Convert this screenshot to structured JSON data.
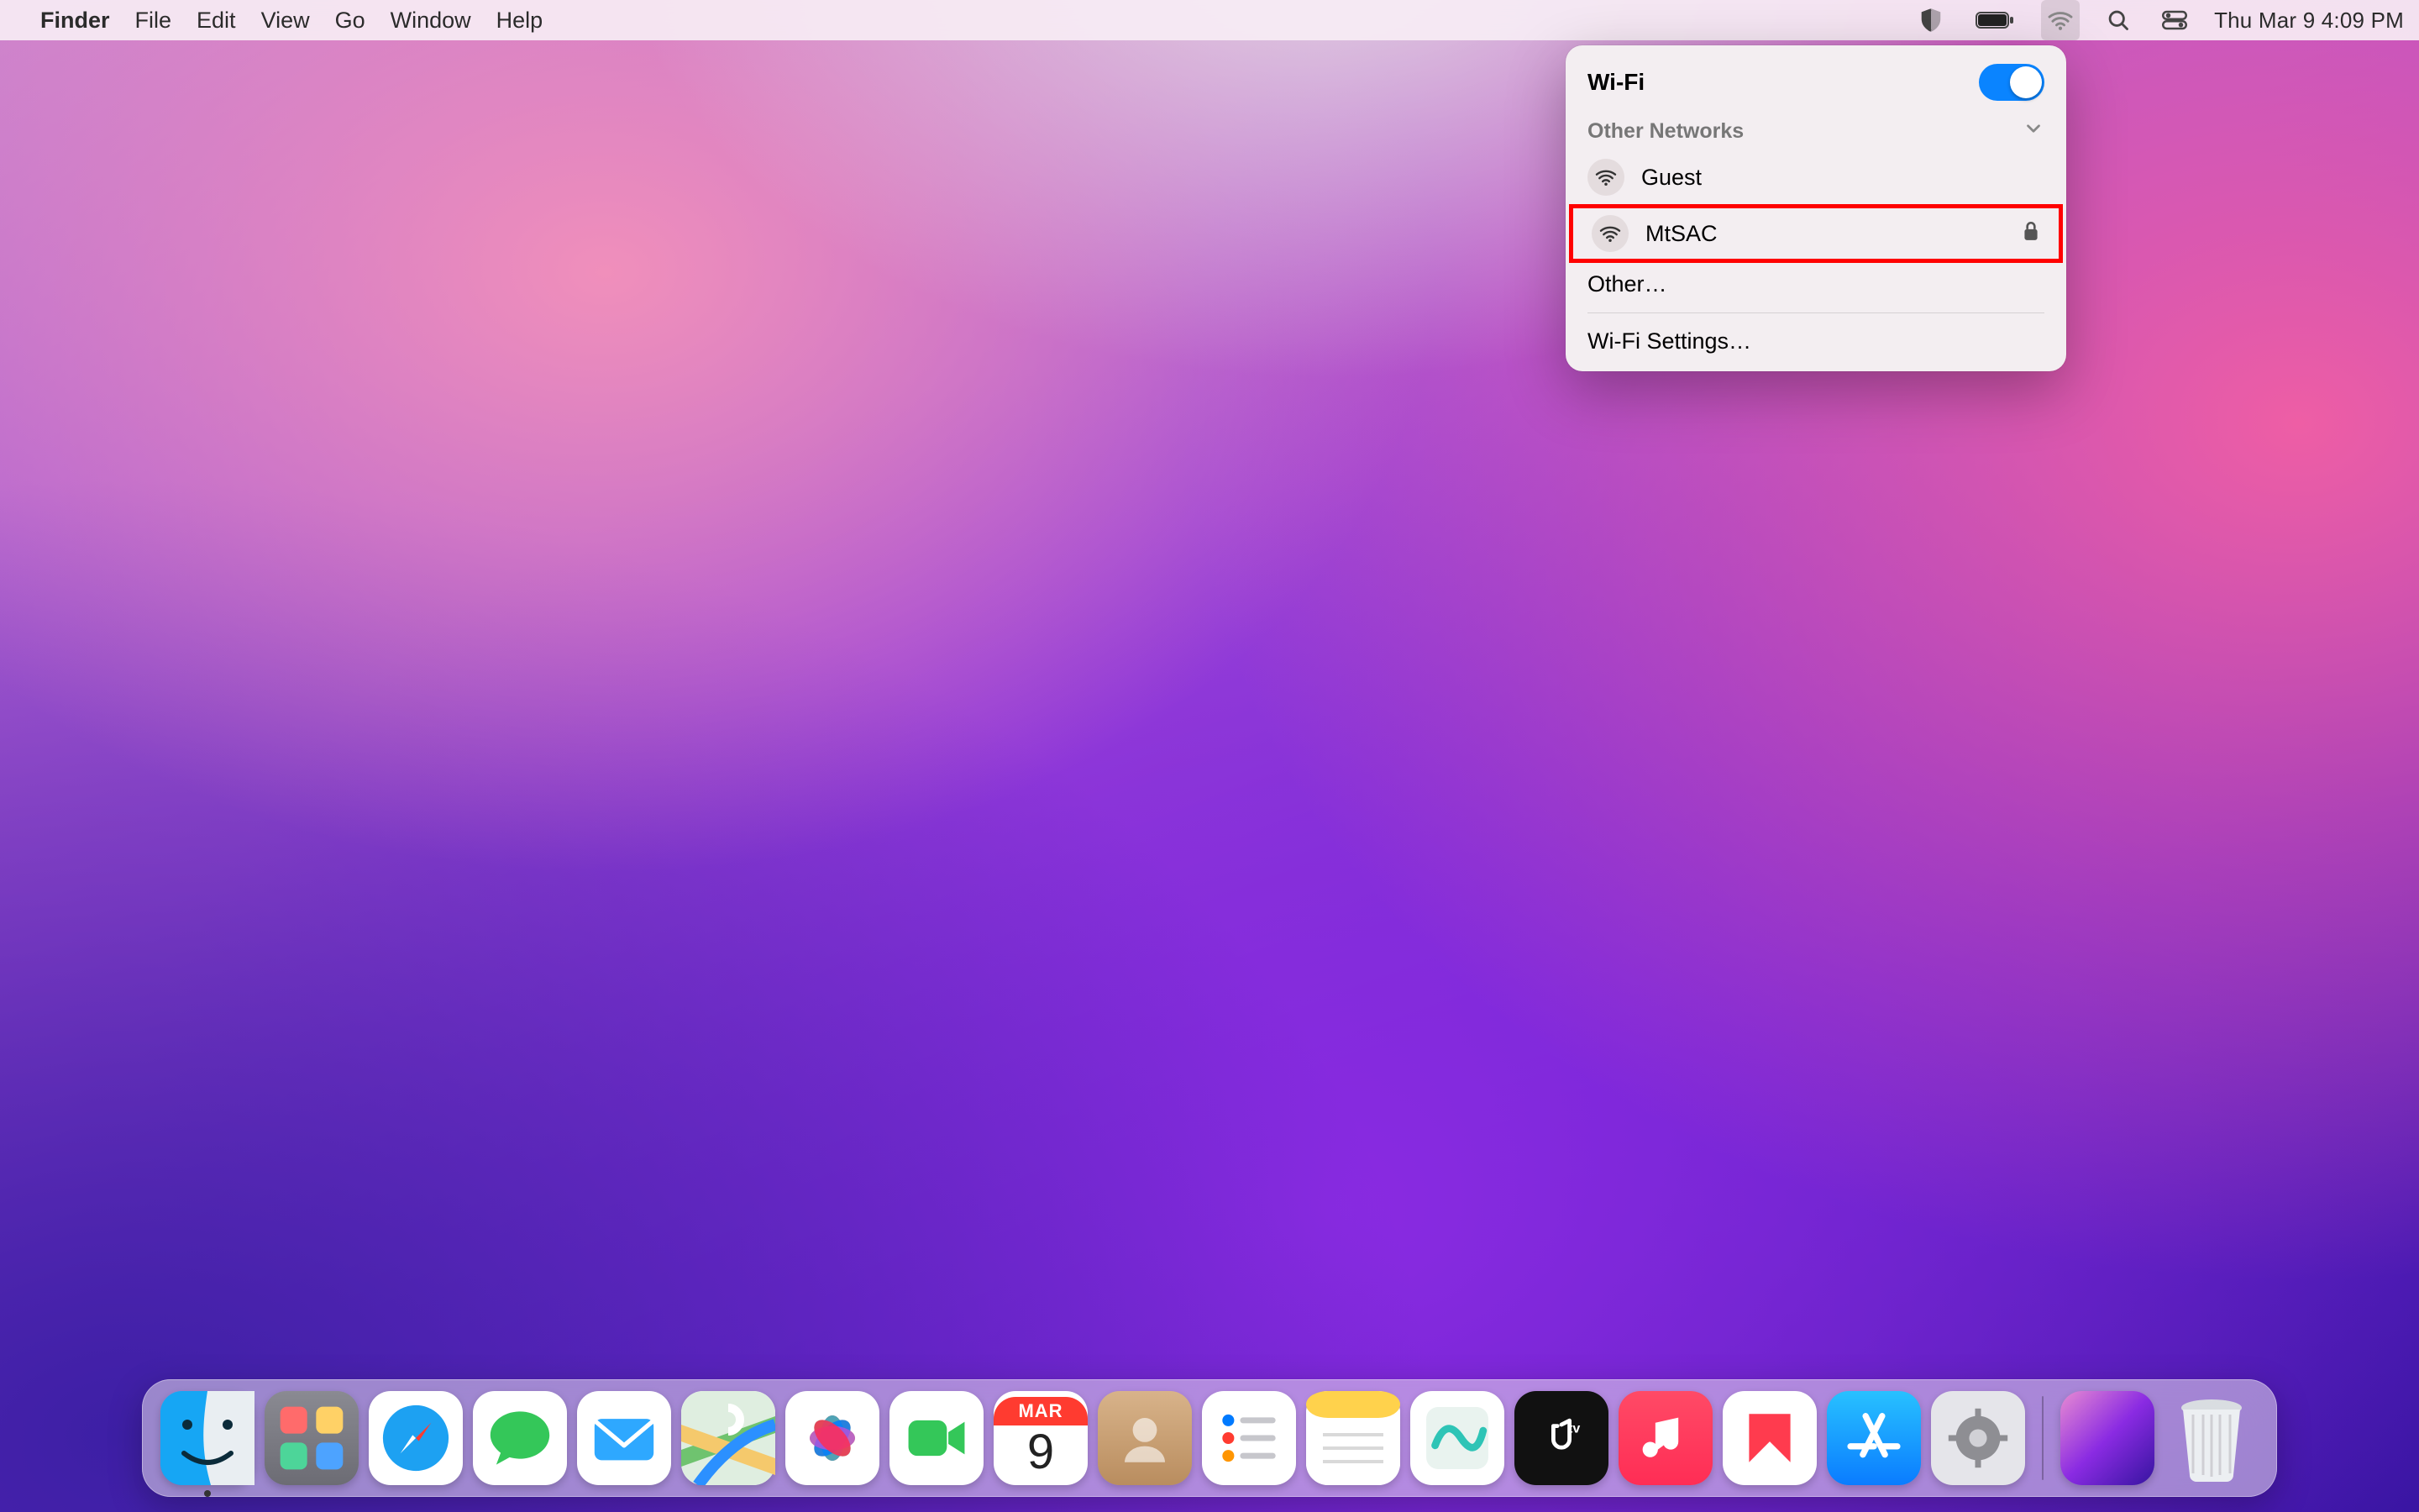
{
  "menubar": {
    "app": "Finder",
    "items": [
      "File",
      "Edit",
      "View",
      "Go",
      "Window",
      "Help"
    ],
    "datetime": "Thu Mar 9  4:09 PM"
  },
  "wifi": {
    "title": "Wi-Fi",
    "enabled": true,
    "section_label": "Other Networks",
    "networks": [
      {
        "name": "Guest",
        "locked": false,
        "highlighted": false
      },
      {
        "name": "MtSAC",
        "locked": true,
        "highlighted": true
      }
    ],
    "other_label": "Other…",
    "settings_label": "Wi-Fi Settings…"
  },
  "calendar": {
    "month": "MAR",
    "day": "9"
  },
  "dock": {
    "apps": [
      "Finder",
      "Launchpad",
      "Safari",
      "Messages",
      "Mail",
      "Maps",
      "Photos",
      "FaceTime",
      "Calendar",
      "Contacts",
      "Reminders",
      "Notes",
      "Freeform",
      "TV",
      "Music",
      "News",
      "App Store",
      "System Settings"
    ]
  }
}
